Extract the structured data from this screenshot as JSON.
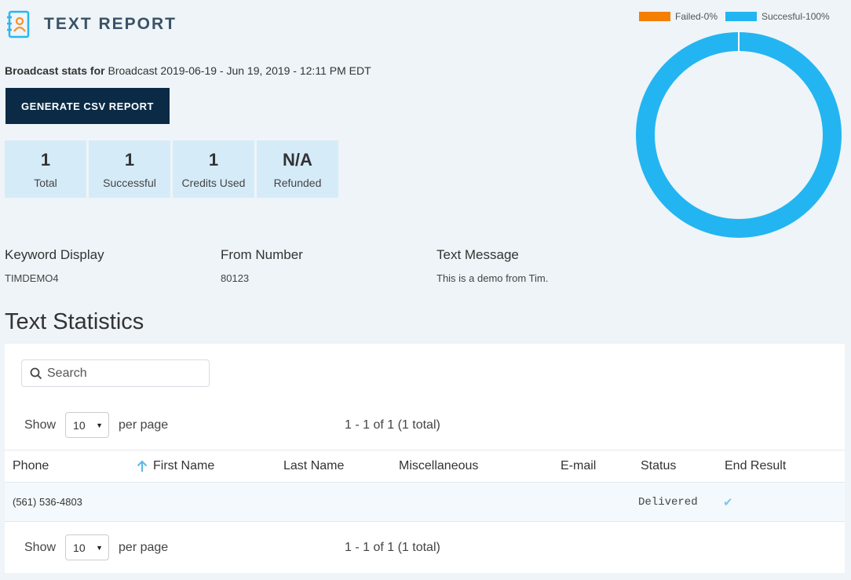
{
  "header": {
    "title": "TEXT REPORT",
    "icon": "contact-book-icon",
    "icon_color": "#f5922f",
    "accent": "#29b6f0"
  },
  "broadcast": {
    "label": "Broadcast stats for",
    "value": "Broadcast 2019-06-19 - Jun 19, 2019 - 12:11 PM EDT"
  },
  "csv_button": "GENERATE CSV REPORT",
  "stats": [
    {
      "value": "1",
      "label": "Total"
    },
    {
      "value": "1",
      "label": "Successful"
    },
    {
      "value": "1",
      "label": "Credits Used"
    },
    {
      "value": "N/A",
      "label": "Refunded"
    }
  ],
  "info": {
    "keyword": {
      "heading": "Keyword Display",
      "value": "TIMDEMO4"
    },
    "from": {
      "heading": "From Number",
      "value": "80123"
    },
    "message": {
      "heading": "Text Message",
      "value": "This is a demo from Tim."
    }
  },
  "section_title": "Text Statistics",
  "table": {
    "search_placeholder": "Search",
    "show_label": "Show",
    "per_page_value": "10",
    "per_page_label": "per page",
    "range_text": "1 - 1 of 1 (1 total)",
    "columns": [
      "Phone",
      "First Name",
      "Last Name",
      "Miscellaneous",
      "E-mail",
      "Status",
      "End Result"
    ],
    "rows": [
      {
        "phone": "(561) 536-4803",
        "first": "",
        "last": "",
        "misc": "",
        "email": "",
        "status": "Delivered",
        "result": "✔"
      }
    ]
  },
  "chart_data": {
    "type": "pie",
    "categories": [
      "Failed-0%",
      "Succesful-100%"
    ],
    "values": [
      0,
      100
    ],
    "colors": [
      "#f57f00",
      "#23b5f1"
    ],
    "legend": "top-right"
  }
}
